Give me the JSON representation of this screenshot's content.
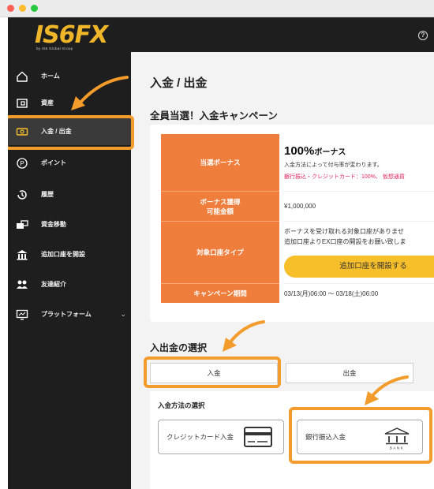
{
  "sidebar": {
    "logo": "IS6FX",
    "logo_sub": "by IS6 Global Group",
    "items": [
      {
        "label": "ホーム",
        "icon": "home-icon"
      },
      {
        "label": "資産",
        "icon": "wallet-icon"
      },
      {
        "label": "入金 / 出金",
        "icon": "cash-icon"
      },
      {
        "label": "ポイント",
        "icon": "points-icon"
      },
      {
        "label": "履歴",
        "icon": "history-icon"
      },
      {
        "label": "資金移動",
        "icon": "transfer-icon"
      },
      {
        "label": "追加口座を開設",
        "icon": "bank-building-icon"
      },
      {
        "label": "友達紹介",
        "icon": "people-icon"
      },
      {
        "label": "プラットフォーム",
        "icon": "monitor-icon"
      }
    ]
  },
  "header": {
    "help_icon": "?"
  },
  "main": {
    "page_title": "入金 / 出金",
    "campaign_title": "全員当選！入金キャンペーン",
    "campaign": {
      "row1_label": "当選ボーナス",
      "bonus_value": "100%",
      "bonus_unit": "ボーナス",
      "bonus_desc": "入金方法によって付与率が変わります。",
      "bonus_rate": "銀行振込・クレジットカード：100%、 仮想通貨",
      "row2_label_a": "ボーナス獲得",
      "row2_label_b": "可能金額",
      "amount": "¥1,000,000",
      "row3_label": "対象口座タイプ",
      "account_note_1": "ボーナスを受け取れる対象口座がありませ",
      "account_note_2": "追加口座よりEX口座の開設をお願い致しま",
      "open_account_button": "追加口座を開設する",
      "row4_label": "キャンペーン期間",
      "period": "03/13(月)06:00 〜 03/18(土)06:00"
    },
    "select_title": "入出金の選択",
    "tab_deposit": "入金",
    "tab_withdraw": "出金",
    "method_title": "入金方法の選択",
    "method_credit": "クレジットカード入金",
    "method_bank": "銀行振込入金",
    "bank_icon_text": "BANK"
  },
  "colors": {
    "accent_orange": "#ef7d3c",
    "highlight": "#f39c2c",
    "button_yellow": "#f7bf2a",
    "sidebar_bg": "#1e1e1e"
  }
}
